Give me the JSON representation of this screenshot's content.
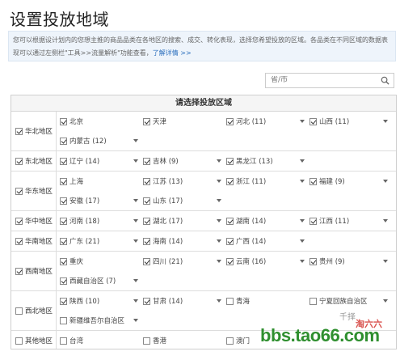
{
  "page": {
    "title": "设置投放地域",
    "notice_text": "您可以根据设计划内的您想主推的商品品类在各地区的搜索、成交、转化表现，选择您希望投放的区域。各品类在不同区域的数据表现可以通过左侧栏\"工具>>流量解析\"功能查看，",
    "notice_link": "了解详情 >>"
  },
  "search": {
    "placeholder": "省/市"
  },
  "panel": {
    "header": "请选择投放区域"
  },
  "regions": [
    {
      "name": "华北地区",
      "checked": true,
      "provinces": [
        {
          "label": "北京",
          "checked": true,
          "caret": false
        },
        {
          "label": "天津",
          "checked": true,
          "caret": false
        },
        {
          "label": "河北 (11)",
          "checked": true,
          "caret": true
        },
        {
          "label": "山西 (11)",
          "checked": true,
          "caret": true
        },
        {
          "label": "内蒙古 (12)",
          "checked": true,
          "caret": true
        }
      ]
    },
    {
      "name": "东北地区",
      "checked": true,
      "provinces": [
        {
          "label": "辽宁 (14)",
          "checked": true,
          "caret": true
        },
        {
          "label": "吉林 (9)",
          "checked": true,
          "caret": true
        },
        {
          "label": "黑龙江 (13)",
          "checked": true,
          "caret": true
        }
      ]
    },
    {
      "name": "华东地区",
      "checked": true,
      "provinces": [
        {
          "label": "上海",
          "checked": true,
          "caret": false
        },
        {
          "label": "江苏 (13)",
          "checked": true,
          "caret": true
        },
        {
          "label": "浙江 (11)",
          "checked": true,
          "caret": true
        },
        {
          "label": "福建 (9)",
          "checked": true,
          "caret": true
        },
        {
          "label": "安徽 (17)",
          "checked": true,
          "caret": true
        },
        {
          "label": "山东 (17)",
          "checked": true,
          "caret": true
        }
      ]
    },
    {
      "name": "华中地区",
      "checked": true,
      "provinces": [
        {
          "label": "河南 (18)",
          "checked": true,
          "caret": true
        },
        {
          "label": "湖北 (17)",
          "checked": true,
          "caret": true
        },
        {
          "label": "湖南 (14)",
          "checked": true,
          "caret": true
        },
        {
          "label": "江西 (11)",
          "checked": true,
          "caret": true
        }
      ]
    },
    {
      "name": "华南地区",
      "checked": true,
      "provinces": [
        {
          "label": "广东 (21)",
          "checked": true,
          "caret": true
        },
        {
          "label": "海南 (14)",
          "checked": true,
          "caret": true
        },
        {
          "label": "广西 (14)",
          "checked": true,
          "caret": true
        }
      ]
    },
    {
      "name": "西南地区",
      "checked": true,
      "provinces": [
        {
          "label": "重庆",
          "checked": true,
          "caret": false
        },
        {
          "label": "四川 (21)",
          "checked": true,
          "caret": true
        },
        {
          "label": "云南 (16)",
          "checked": true,
          "caret": true
        },
        {
          "label": "贵州 (9)",
          "checked": true,
          "caret": true
        },
        {
          "label": "西藏自治区 (7)",
          "checked": true,
          "caret": true
        }
      ]
    },
    {
      "name": "西北地区",
      "checked": false,
      "provinces": [
        {
          "label": "陕西 (10)",
          "checked": true,
          "caret": true
        },
        {
          "label": "甘肃 (14)",
          "checked": true,
          "caret": true
        },
        {
          "label": "青海",
          "checked": false,
          "caret": false
        },
        {
          "label": "宁夏回族自治区",
          "checked": false,
          "caret": true
        },
        {
          "label": "新疆维吾尔自治区",
          "checked": false,
          "caret": true
        }
      ]
    },
    {
      "name": "其他地区",
      "checked": false,
      "provinces": [
        {
          "label": "台湾",
          "checked": false,
          "caret": false
        },
        {
          "label": "香港",
          "checked": false,
          "caret": false
        },
        {
          "label": "澳门",
          "checked": false,
          "caret": false
        }
      ]
    }
  ],
  "watermark": {
    "url": "bbs.tao66.com",
    "brand": "淘六六",
    "tag": "千择"
  },
  "colors": {
    "accent": "#2a6ebd",
    "watermark": "#2f8f2f"
  }
}
